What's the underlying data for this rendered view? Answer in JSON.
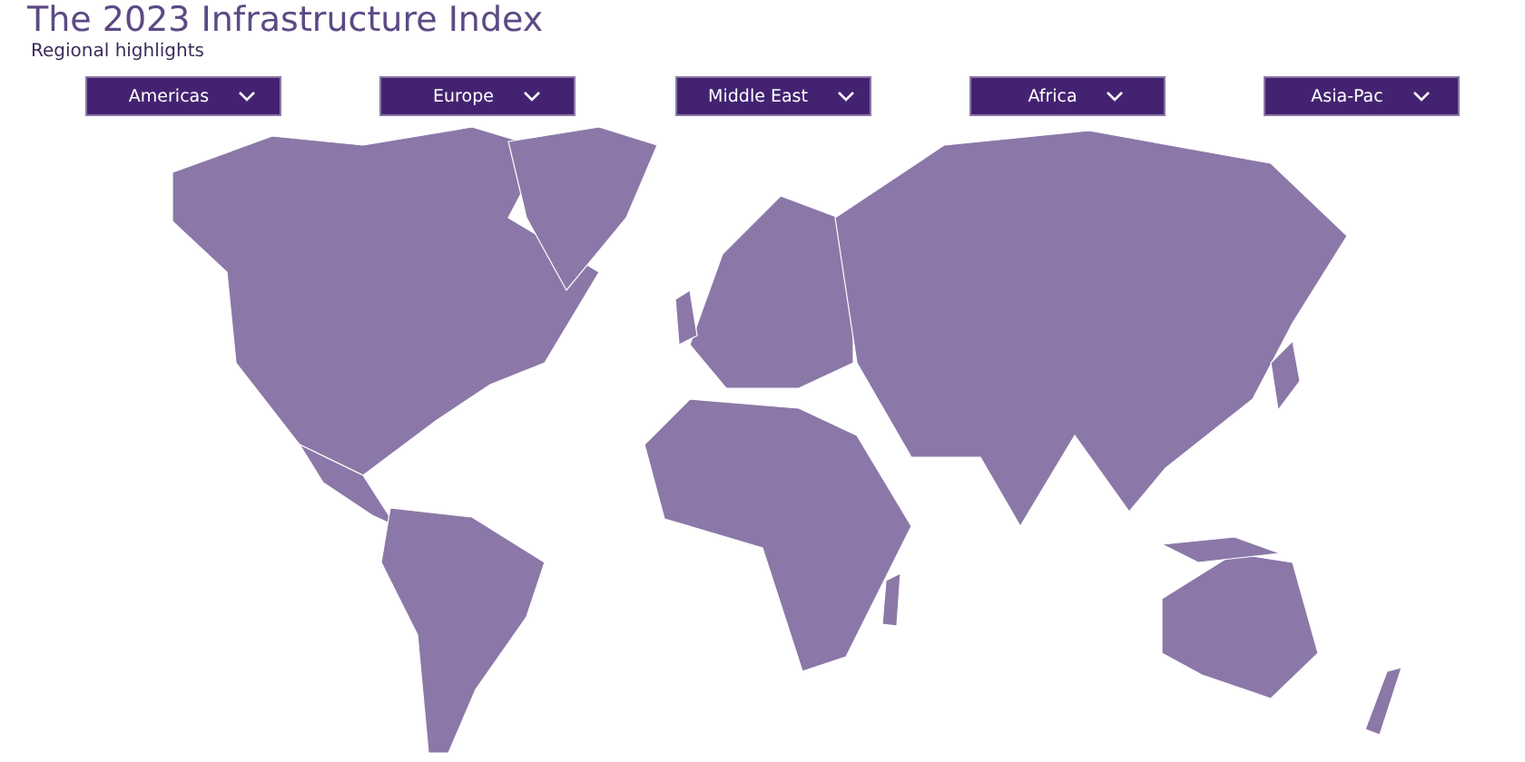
{
  "title": "The 2023 Infrastructure Index",
  "subtitle": "Regional highlights",
  "regions": [
    {
      "label": "Americas"
    },
    {
      "label": "Europe"
    },
    {
      "label": "Middle East"
    },
    {
      "label": "Africa"
    },
    {
      "label": "Asia-Pac"
    }
  ]
}
